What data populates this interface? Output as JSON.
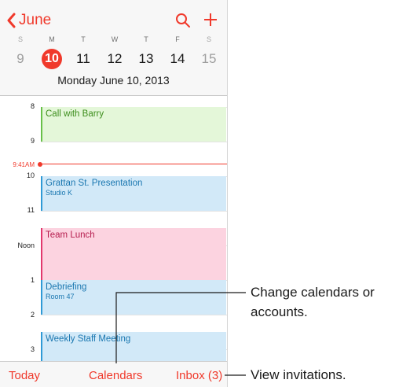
{
  "nav": {
    "back_label": "June"
  },
  "week": {
    "days": [
      {
        "letter": "S",
        "date": "9",
        "weekend": true,
        "selected": false
      },
      {
        "letter": "M",
        "date": "10",
        "weekend": false,
        "selected": true
      },
      {
        "letter": "T",
        "date": "11",
        "weekend": false,
        "selected": false
      },
      {
        "letter": "W",
        "date": "12",
        "weekend": false,
        "selected": false
      },
      {
        "letter": "T",
        "date": "13",
        "weekend": false,
        "selected": false
      },
      {
        "letter": "F",
        "date": "14",
        "weekend": false,
        "selected": false
      },
      {
        "letter": "S",
        "date": "15",
        "weekend": true,
        "selected": false
      }
    ],
    "selected_full_date": "Monday  June 10, 2013"
  },
  "timeline": {
    "hours": [
      "8",
      "9",
      "10",
      "11",
      "Noon",
      "1",
      "2",
      "3"
    ],
    "now_label": "9:41AM",
    "events": [
      {
        "title": "Call with Barry",
        "location": "",
        "color": "green"
      },
      {
        "title": "Grattan St. Presentation",
        "location": "Studio K",
        "color": "blue"
      },
      {
        "title": "Team Lunch",
        "location": "",
        "color": "pink"
      },
      {
        "title": "Debriefing",
        "location": "Room 47",
        "color": "blue"
      },
      {
        "title": "Weekly Staff Meeting",
        "location": "",
        "color": "blue"
      }
    ]
  },
  "toolbar": {
    "today": "Today",
    "calendars": "Calendars",
    "inbox": "Inbox (3)"
  },
  "callouts": {
    "calendars_line1": "Change calendars or",
    "calendars_line2": "accounts.",
    "inbox": "View invitations."
  },
  "colors": {
    "accent": "#f0392b",
    "green": "#68c049",
    "blue": "#2f9ad6",
    "pink": "#e2376d"
  },
  "icons": [
    "chevron-left-icon",
    "search-icon",
    "plus-icon"
  ]
}
